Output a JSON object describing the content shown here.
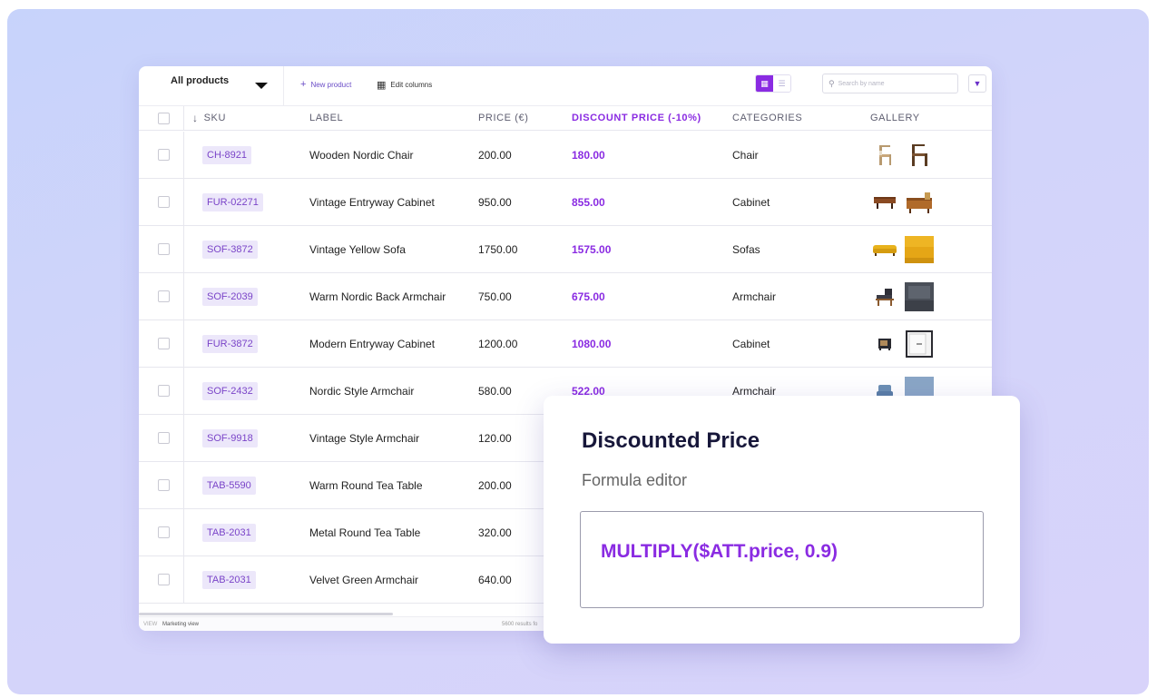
{
  "toolbar": {
    "view_selector": "All products",
    "new_product": "New product",
    "edit_columns": "Edit columns",
    "search_placeholder": "Search by name"
  },
  "columns": [
    "SKU",
    "LABEL",
    "PRICE (€)",
    "DISCOUNT PRICE (-10%)",
    "CATEGORIES",
    "GALLERY"
  ],
  "products": [
    {
      "sku": "CH-8921",
      "label": "Wooden Nordic Chair",
      "price": "200.00",
      "discount": "180.00",
      "category": "Chair"
    },
    {
      "sku": "FUR-02271",
      "label": "Vintage Entryway Cabinet",
      "price": "950.00",
      "discount": "855.00",
      "category": "Cabinet"
    },
    {
      "sku": "SOF-3872",
      "label": "Vintage Yellow Sofa",
      "price": "1750.00",
      "discount": "1575.00",
      "category": "Sofas"
    },
    {
      "sku": "SOF-2039",
      "label": "Warm Nordic Back Armchair",
      "price": "750.00",
      "discount": "675.00",
      "category": "Armchair"
    },
    {
      "sku": "FUR-3872",
      "label": "Modern Entryway Cabinet",
      "price": "1200.00",
      "discount": "1080.00",
      "category": "Cabinet"
    },
    {
      "sku": "SOF-2432",
      "label": "Nordic Style Armchair",
      "price": "580.00",
      "discount": "522.00",
      "category": "Armchair"
    },
    {
      "sku": "SOF-9918",
      "label": "Vintage Style Armchair",
      "price": "120.00",
      "discount": "",
      "category": ""
    },
    {
      "sku": "TAB-5590",
      "label": "Warm Round Tea Table",
      "price": "200.00",
      "discount": "",
      "category": ""
    },
    {
      "sku": "TAB-2031",
      "label": "Metal Round Tea Table",
      "price": "320.00",
      "discount": "",
      "category": ""
    },
    {
      "sku": "TAB-2031",
      "label": "Velvet Green Armchair",
      "price": "640.00",
      "discount": "",
      "category": ""
    }
  ],
  "footer": {
    "view_label": "VIEW",
    "view_name": "Marketing view",
    "results": "5600 results fo"
  },
  "editor": {
    "title": "Discounted Price",
    "subtitle": "Formula editor",
    "formula": "MULTIPLY($ATT.price, 0.9)"
  },
  "colors": {
    "accent": "#8a2be2",
    "sku_chip_bg": "#ece7fa",
    "background": "#cdd5fb"
  },
  "icons": {
    "sort": "arrow-down-icon",
    "add": "plus-icon",
    "columns": "columns-icon",
    "search": "search-icon",
    "filter": "filter-icon"
  }
}
